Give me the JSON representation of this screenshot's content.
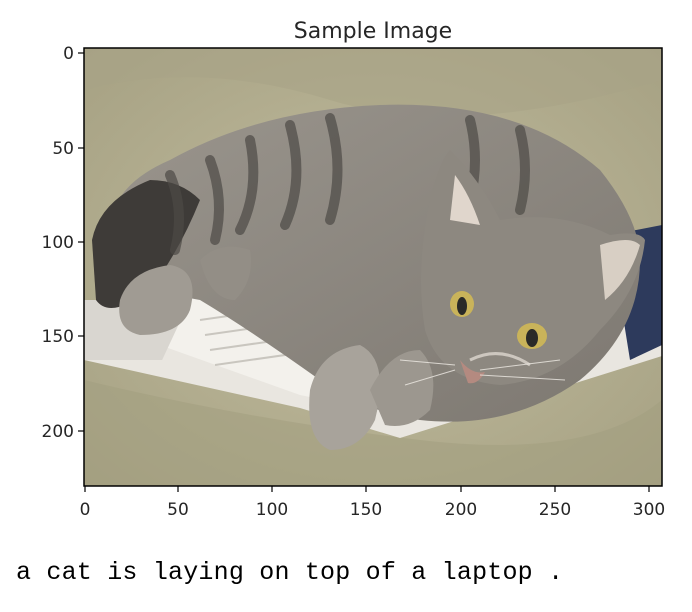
{
  "figure": {
    "title": "Sample Image",
    "x_ticks": [
      "0",
      "50",
      "100",
      "150",
      "200",
      "250",
      "300"
    ],
    "y_ticks": [
      "0",
      "50",
      "100",
      "150",
      "200"
    ]
  },
  "image": {
    "subject": "grey tabby cat lying on a white laptop on an olive blanket",
    "colors": {
      "background": "#b5b091",
      "cat_fur": "#8f8a83",
      "cat_stripes": "#4a4743",
      "laptop": "#ece9e4",
      "eyes": "#c9b35a"
    }
  },
  "caption": "a cat is laying on top of a laptop ."
}
